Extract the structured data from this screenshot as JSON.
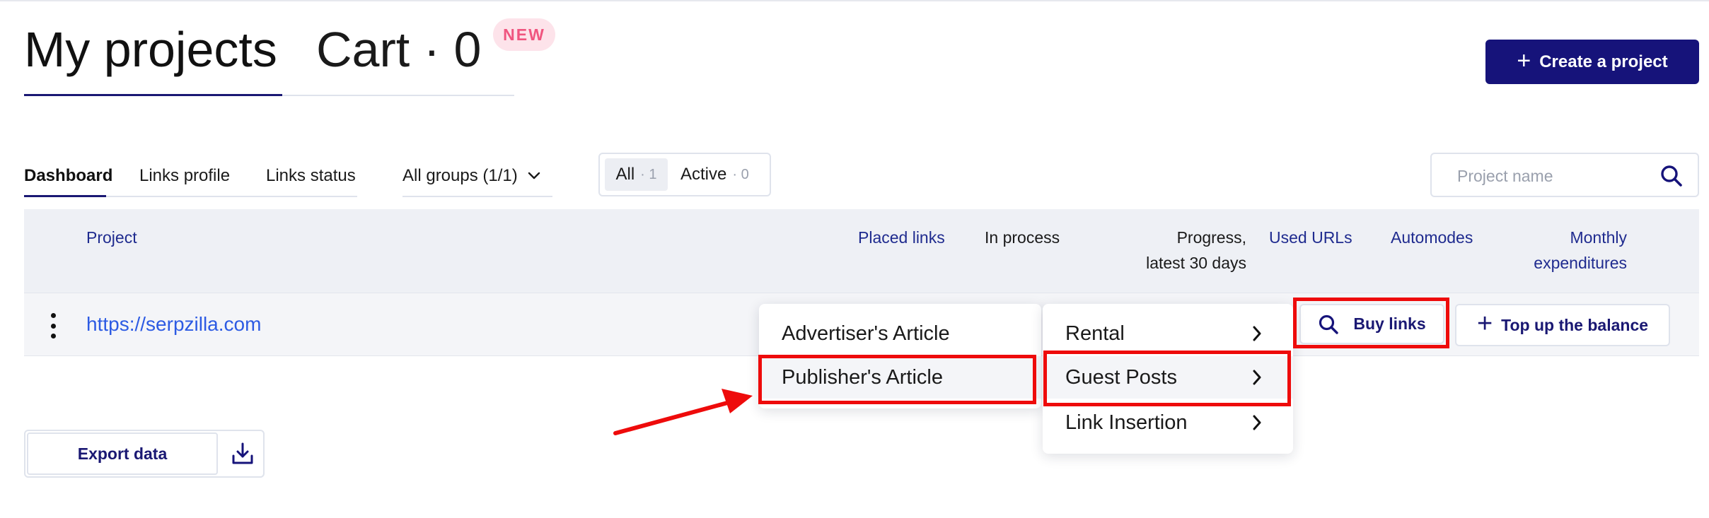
{
  "header": {
    "tabs": [
      {
        "label": "My projects",
        "active": true
      },
      {
        "label": "Cart · 0",
        "active": false
      }
    ],
    "new_badge": "NEW",
    "create_button": {
      "label": "Create a project",
      "icon": "plus-icon"
    }
  },
  "subtabs": [
    {
      "label": "Dashboard",
      "active": true
    },
    {
      "label": "Links profile",
      "active": false
    },
    {
      "label": "Links status",
      "active": false
    }
  ],
  "group_select": {
    "value": "All groups (1/1)",
    "icon": "chevron-down-icon"
  },
  "filter": {
    "all": {
      "label": "All",
      "count": "· 1",
      "selected": true
    },
    "active": {
      "label": "Active",
      "count": "· 0",
      "selected": false
    }
  },
  "search": {
    "placeholder": "Project name",
    "icon": "search-icon"
  },
  "table": {
    "columns": {
      "project": "Project",
      "placed_links": "Placed links",
      "in_process": "In process",
      "progress_line1": "Progress,",
      "progress_line2": "latest 30 days",
      "used_urls": "Used URLs",
      "automodes": "Automodes",
      "monthly_line1": "Monthly",
      "monthly_line2": "expenditures"
    },
    "rows": [
      {
        "project_url": "https://serpzilla.com",
        "buy_links_label": "Buy links",
        "top_up_label": "Top up the balance"
      }
    ]
  },
  "menus": {
    "left": [
      "Advertiser's Article",
      "Publisher's Article"
    ],
    "right": [
      "Rental",
      "Guest Posts",
      "Link Insertion"
    ]
  },
  "colors": {
    "primary": "#16137a",
    "link": "#2d5be3",
    "annotation_red": "#ee0b0b",
    "new_badge_bg": "#fde3ea",
    "new_badge_text": "#f0557f"
  },
  "export": {
    "label": "Export data",
    "icon": "download-icon"
  }
}
